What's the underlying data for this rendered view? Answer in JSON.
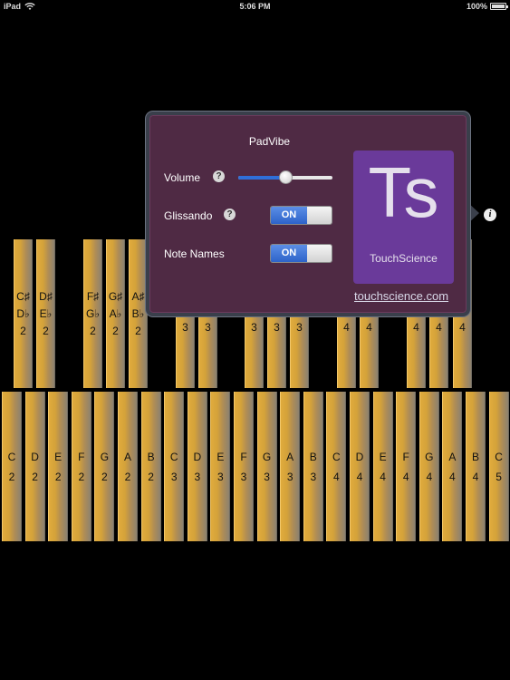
{
  "status_bar": {
    "device": "iPad",
    "time": "5:06 PM",
    "battery": "100%"
  },
  "black_keys": [
    {
      "label": "C♯\nD♭\n2"
    },
    {
      "label": "D♯\nE♭\n2"
    },
    {
      "label": "F♯\nG♭\n2"
    },
    {
      "label": "G♯\nA♭\n2"
    },
    {
      "label": "A♯\nB♭\n2"
    },
    {
      "label": "3"
    },
    {
      "label": "3"
    },
    {
      "label": "3"
    },
    {
      "label": "3"
    },
    {
      "label": "3"
    },
    {
      "label": "4"
    },
    {
      "label": "4"
    },
    {
      "label": "4"
    },
    {
      "label": "4"
    },
    {
      "label": "4"
    }
  ],
  "white_keys": [
    {
      "note": "C",
      "octave": "2"
    },
    {
      "note": "D",
      "octave": "2"
    },
    {
      "note": "E",
      "octave": "2"
    },
    {
      "note": "F",
      "octave": "2"
    },
    {
      "note": "G",
      "octave": "2"
    },
    {
      "note": "A",
      "octave": "2"
    },
    {
      "note": "B",
      "octave": "2"
    },
    {
      "note": "C",
      "octave": "3"
    },
    {
      "note": "D",
      "octave": "3"
    },
    {
      "note": "E",
      "octave": "3"
    },
    {
      "note": "F",
      "octave": "3"
    },
    {
      "note": "G",
      "octave": "3"
    },
    {
      "note": "A",
      "octave": "3"
    },
    {
      "note": "B",
      "octave": "3"
    },
    {
      "note": "C",
      "octave": "4"
    },
    {
      "note": "D",
      "octave": "4"
    },
    {
      "note": "E",
      "octave": "4"
    },
    {
      "note": "F",
      "octave": "4"
    },
    {
      "note": "G",
      "octave": "4"
    },
    {
      "note": "A",
      "octave": "4"
    },
    {
      "note": "B",
      "octave": "4"
    },
    {
      "note": "C",
      "octave": "5"
    }
  ],
  "popover": {
    "title": "PadVibe",
    "volume_label": "Volume",
    "volume_level": 0.5,
    "glissando_label": "Glissando",
    "glissando_state": "ON",
    "note_names_label": "Note Names",
    "note_names_state": "ON",
    "help_glyph": "?",
    "logo_letters": "Ts",
    "logo_name": "TouchScience",
    "link_text": "touchscience.com"
  },
  "info_glyph": "i",
  "colors": {
    "background": "#000000",
    "popover": "#4f2a44",
    "logo": "#6a3a9a",
    "toggle_on": "#2d63c9",
    "bar_gold": "#d4a23a"
  }
}
